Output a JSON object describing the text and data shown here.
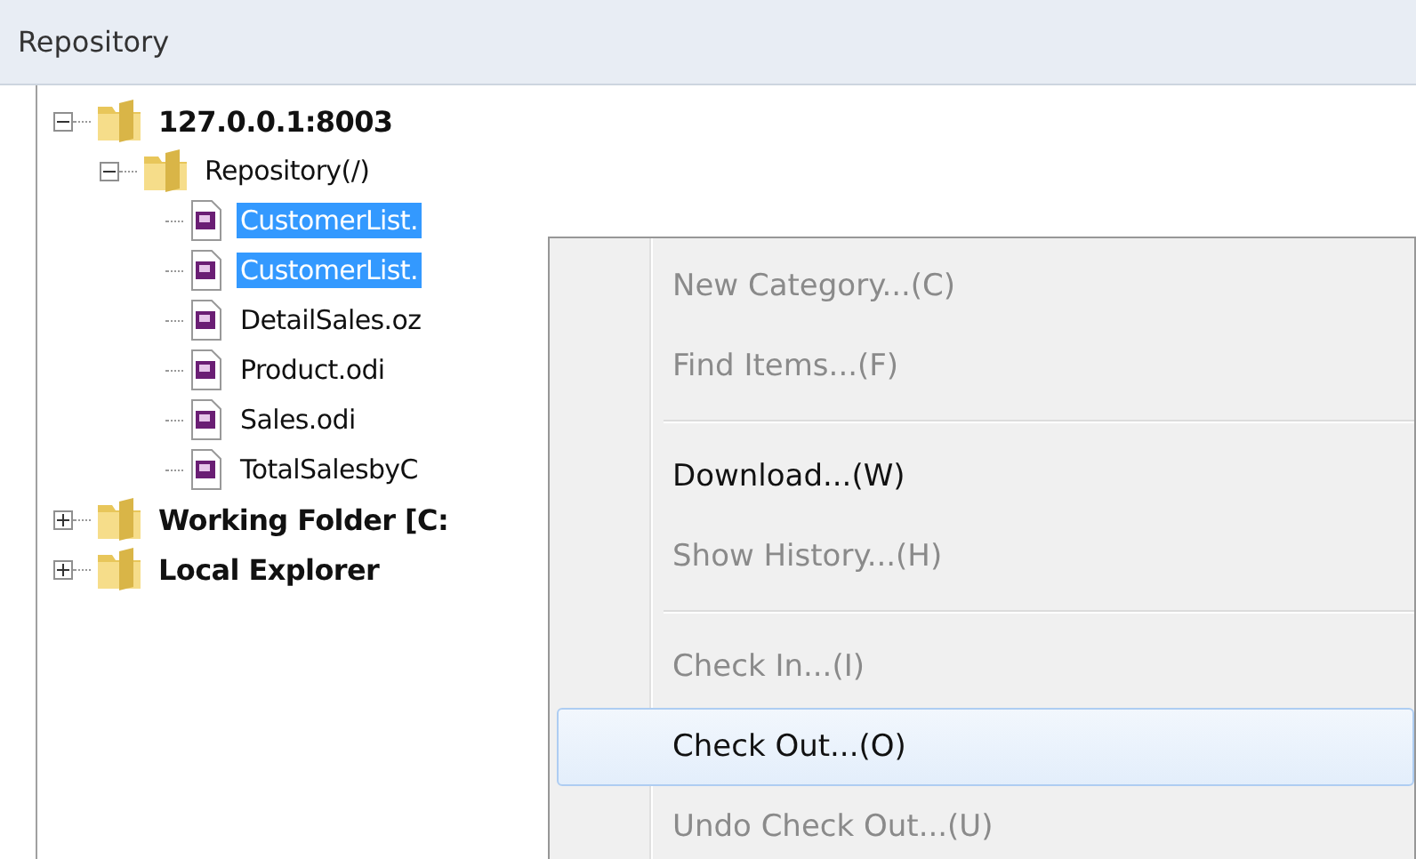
{
  "panel": {
    "title": "Repository"
  },
  "tree": [
    {
      "label": "127.0.0.1:8003",
      "kind": "server",
      "expanded": true,
      "selected": false,
      "children": [
        {
          "label": "Repository(/)",
          "kind": "folder",
          "expanded": true,
          "selected": false,
          "children": [
            {
              "label": "CustomerList.",
              "kind": "file",
              "selected": true
            },
            {
              "label": "CustomerList.",
              "kind": "file",
              "selected": true
            },
            {
              "label": "DetailSales.oz",
              "kind": "file",
              "selected": false
            },
            {
              "label": "Product.odi",
              "kind": "file",
              "selected": false
            },
            {
              "label": "Sales.odi",
              "kind": "file",
              "selected": false
            },
            {
              "label": "TotalSalesbyC",
              "kind": "file",
              "selected": false
            }
          ]
        }
      ]
    },
    {
      "label": "Working Folder [C:",
      "kind": "server",
      "expanded": false,
      "selected": false
    },
    {
      "label": "Local Explorer",
      "kind": "server",
      "expanded": false,
      "selected": false
    }
  ],
  "context_menu": [
    {
      "kind": "item",
      "label": "New Category...(C)",
      "disabled": true,
      "selected": false
    },
    {
      "kind": "item",
      "label": "Find Items...(F)",
      "disabled": true,
      "selected": false
    },
    {
      "kind": "separator"
    },
    {
      "kind": "item",
      "label": "Download...(W)",
      "disabled": false,
      "selected": false
    },
    {
      "kind": "item",
      "label": "Show History...(H)",
      "disabled": true,
      "selected": false
    },
    {
      "kind": "separator"
    },
    {
      "kind": "item",
      "label": "Check In...(I)",
      "disabled": true,
      "selected": false
    },
    {
      "kind": "item",
      "label": "Check Out...(O)",
      "disabled": false,
      "selected": true
    },
    {
      "kind": "item",
      "label": "Undo Check Out...(U)",
      "disabled": true,
      "selected": false
    }
  ]
}
